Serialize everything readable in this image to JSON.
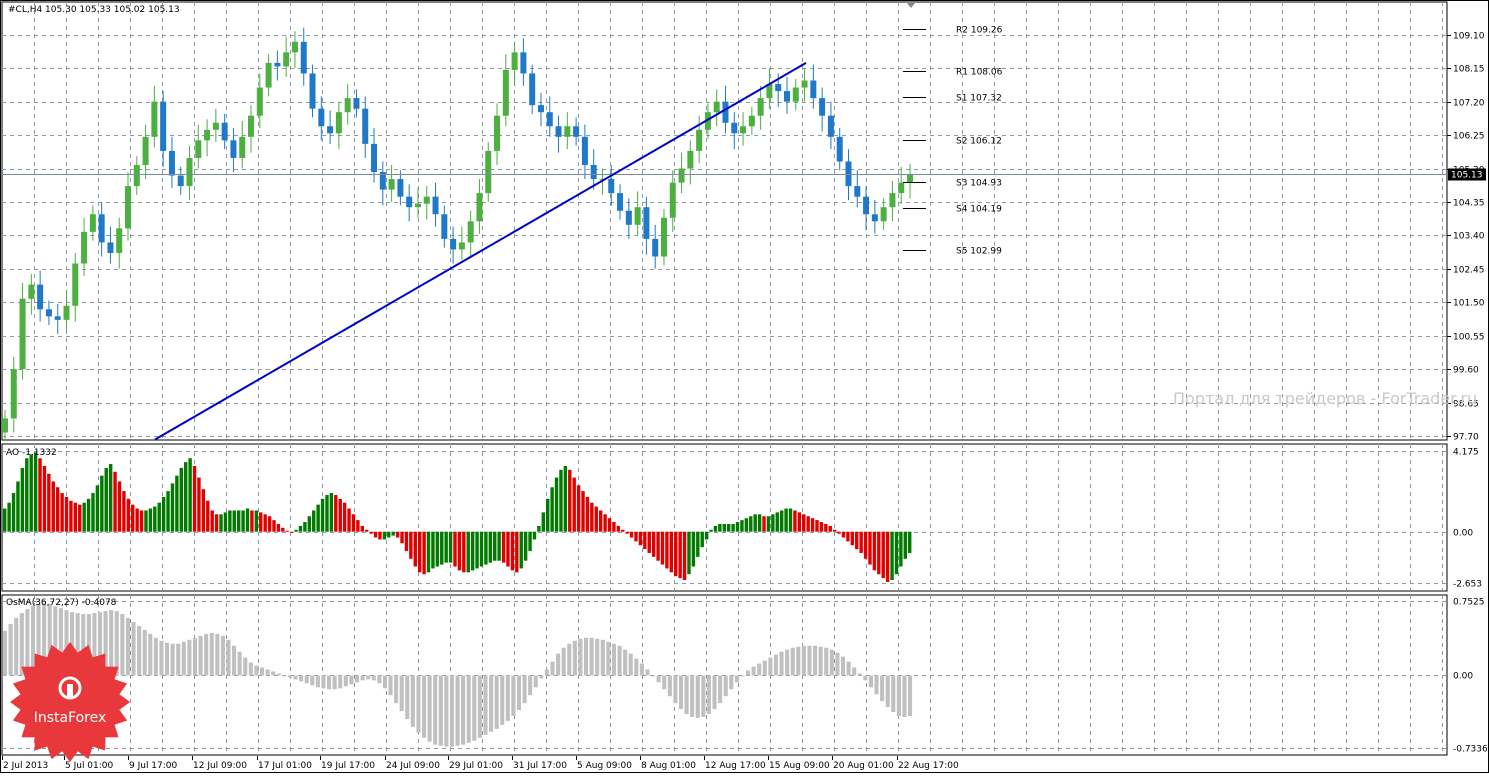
{
  "symbol_header": "#CL,H4  105.30 105.33 105.02 105.13",
  "watermark": "Портал для трейдеров - ForTrader.ru",
  "logo_text": "InstaForex",
  "colors": {
    "bull": "#4caf3f",
    "bear": "#1f78c8",
    "trendline": "#0000cc",
    "ao_up": "#007b00",
    "ao_down": "#e00000",
    "osma": "#c0c0c0",
    "grid": "#8a9aab",
    "logo": "#e8383b"
  },
  "price_panel": {
    "current_price": "105.13",
    "current_value": 105.13,
    "y_ticks": [
      "109.10",
      "108.15",
      "107.20",
      "106.25",
      "105.30",
      "104.35",
      "103.40",
      "102.45",
      "101.50",
      "100.55",
      "99.60",
      "98.65",
      "97.70"
    ],
    "y_values": [
      109.1,
      108.15,
      107.2,
      106.25,
      105.3,
      104.35,
      103.4,
      102.45,
      101.5,
      100.55,
      99.6,
      98.65,
      97.7
    ],
    "ylim": [
      97.7,
      109.86
    ],
    "pivots": [
      {
        "label": "R2 109.26",
        "value": 109.26
      },
      {
        "label": "R1 108.06",
        "value": 108.06
      },
      {
        "label": "S1 107.32",
        "value": 107.32
      },
      {
        "label": "S2 106.12",
        "value": 106.12
      },
      {
        "label": "S3 104.93",
        "value": 104.93
      },
      {
        "label": "S4 104.19",
        "value": 104.19
      },
      {
        "label": "S5 102.99",
        "value": 102.99
      }
    ]
  },
  "ao_panel": {
    "label": "AO -1.1332",
    "y_ticks": [
      "4.175",
      "0.00",
      "-2.653"
    ],
    "y_values": [
      4.175,
      0.0,
      -2.653
    ],
    "ylim": [
      -2.653,
      4.175
    ]
  },
  "osma_panel": {
    "label": "OsMA(36,72,27) -0.4078",
    "y_ticks": [
      "0.7525",
      "0.00",
      "-0.7336"
    ],
    "y_values": [
      0.7525,
      0.0,
      -0.7336
    ],
    "ylim": [
      -0.7336,
      0.7525
    ]
  },
  "x_ticks": [
    "2 Jul 2013",
    "5 Jul 01:00",
    "9 Jul 17:00",
    "12 Jul 09:00",
    "17 Jul 01:00",
    "19 Jul 17:00",
    "24 Jul 09:00",
    "29 Jul 01:00",
    "31 Jul 17:00",
    "5 Aug 09:00",
    "8 Aug 01:00",
    "12 Aug 17:00",
    "15 Aug 09:00",
    "20 Aug 01:00",
    "22 Aug 17:00"
  ],
  "chart_data": [
    {
      "type": "candlestick",
      "title": "#CL,H4",
      "ohlc_last": {
        "open": 105.3,
        "high": 105.33,
        "low": 105.02,
        "close": 105.13
      },
      "x_labels": [
        "2 Jul 2013",
        "5 Jul 01:00",
        "9 Jul 17:00",
        "12 Jul 09:00",
        "17 Jul 01:00",
        "19 Jul 17:00",
        "24 Jul 09:00",
        "29 Jul 01:00",
        "31 Jul 17:00",
        "5 Aug 09:00",
        "8 Aug 01:00",
        "12 Aug 17:00",
        "15 Aug 09:00",
        "20 Aug 01:00",
        "22 Aug 17:00"
      ],
      "close_path": [
        98.2,
        99.6,
        101.6,
        102.0,
        101.3,
        101.1,
        101.0,
        101.4,
        102.6,
        103.5,
        104.0,
        103.2,
        102.9,
        103.6,
        104.8,
        105.4,
        106.2,
        107.2,
        105.8,
        105.1,
        104.8,
        105.6,
        106.1,
        106.4,
        106.6,
        106.1,
        105.6,
        106.2,
        106.8,
        107.6,
        108.3,
        108.2,
        108.6,
        108.9,
        108.0,
        107.0,
        106.5,
        106.3,
        106.9,
        107.3,
        107.0,
        106.0,
        105.2,
        104.7,
        105.0,
        104.5,
        104.2,
        104.3,
        104.5,
        104.0,
        103.3,
        103.0,
        103.2,
        103.8,
        104.6,
        105.8,
        106.8,
        108.1,
        108.6,
        108.0,
        107.1,
        106.9,
        106.5,
        106.2,
        106.5,
        106.2,
        105.4,
        105.0,
        105.0,
        104.6,
        104.1,
        103.7,
        104.2,
        103.3,
        102.8,
        103.9,
        104.9,
        105.3,
        105.8,
        106.4,
        106.9,
        107.2,
        106.6,
        106.3,
        106.5,
        106.8,
        107.3,
        107.7,
        107.5,
        107.2,
        107.6,
        107.8,
        107.3,
        106.8,
        106.2,
        105.5,
        104.8,
        104.5,
        104.0,
        103.8,
        104.2,
        104.6,
        104.9,
        105.13
      ],
      "trendline": {
        "from": {
          "x": "5 Jul 01:00",
          "y": 97.6
        },
        "to": {
          "x": "15 Aug 09:00",
          "y": 108.3
        }
      }
    },
    {
      "type": "bar",
      "title": "AO -1.1332",
      "values": [
        1.2,
        1.5,
        2.0,
        2.6,
        3.3,
        3.8,
        4.0,
        4.1,
        3.8,
        3.4,
        3.0,
        2.6,
        2.3,
        2.0,
        1.8,
        1.6,
        1.5,
        1.4,
        1.5,
        1.7,
        2.0,
        2.4,
        2.9,
        3.3,
        3.5,
        3.1,
        2.6,
        2.1,
        1.7,
        1.4,
        1.2,
        1.1,
        1.1,
        1.2,
        1.3,
        1.5,
        1.8,
        2.1,
        2.5,
        2.9,
        3.3,
        3.6,
        3.8,
        3.4,
        2.8,
        2.2,
        1.6,
        1.1,
        0.9,
        0.9,
        1.0,
        1.1,
        1.1,
        1.1,
        1.1,
        1.2,
        1.1,
        1.1,
        1.0,
        0.9,
        0.8,
        0.6,
        0.4,
        0.2,
        0.05,
        0.0,
        0.1,
        0.3,
        0.5,
        0.8,
        1.1,
        1.4,
        1.7,
        1.9,
        2.0,
        1.9,
        1.7,
        1.5,
        1.2,
        0.9,
        0.6,
        0.3,
        0.1,
        -0.1,
        -0.3,
        -0.4,
        -0.4,
        -0.3,
        -0.2,
        -0.3,
        -0.6,
        -1.0,
        -1.4,
        -1.8,
        -2.1,
        -2.2,
        -2.1,
        -1.9,
        -1.8,
        -1.7,
        -1.6,
        -1.6,
        -1.8,
        -2.0,
        -2.1,
        -2.1,
        -2.0,
        -1.9,
        -1.8,
        -1.7,
        -1.6,
        -1.5,
        -1.5,
        -1.6,
        -1.8,
        -2.0,
        -2.1,
        -1.9,
        -1.5,
        -1.0,
        -0.4,
        0.3,
        1.0,
        1.7,
        2.3,
        2.8,
        3.2,
        3.4,
        3.2,
        2.8,
        2.4,
        2.1,
        1.8,
        1.5,
        1.3,
        1.1,
        0.9,
        0.7,
        0.5,
        0.3,
        0.1,
        -0.1,
        -0.3,
        -0.5,
        -0.7,
        -0.9,
        -1.1,
        -1.3,
        -1.5,
        -1.7,
        -1.9,
        -2.1,
        -2.3,
        -2.4,
        -2.5,
        -2.2,
        -1.8,
        -1.3,
        -0.8,
        -0.4,
        0.1,
        0.3,
        0.4,
        0.4,
        0.4,
        0.4,
        0.5,
        0.6,
        0.7,
        0.8,
        0.9,
        0.9,
        0.8,
        0.8,
        0.9,
        1.0,
        1.1,
        1.2,
        1.2,
        1.1,
        1.0,
        0.9,
        0.8,
        0.7,
        0.6,
        0.5,
        0.4,
        0.3,
        0.1,
        -0.1,
        -0.3,
        -0.5,
        -0.7,
        -0.9,
        -1.1,
        -1.4,
        -1.7,
        -2.0,
        -2.2,
        -2.4,
        -2.6,
        -2.5,
        -2.2,
        -1.8,
        -1.4,
        -1.1
      ]
    },
    {
      "type": "bar",
      "title": "OsMA(36,72,27) -0.4078",
      "values": [
        0.45,
        0.52,
        0.58,
        0.63,
        0.67,
        0.7,
        0.72,
        0.73,
        0.72,
        0.7,
        0.68,
        0.66,
        0.64,
        0.63,
        0.62,
        0.62,
        0.63,
        0.64,
        0.65,
        0.66,
        0.65,
        0.62,
        0.58,
        0.54,
        0.5,
        0.46,
        0.42,
        0.38,
        0.35,
        0.33,
        0.32,
        0.32,
        0.34,
        0.36,
        0.38,
        0.4,
        0.42,
        0.43,
        0.42,
        0.4,
        0.36,
        0.3,
        0.24,
        0.18,
        0.13,
        0.1,
        0.08,
        0.06,
        0.04,
        0.02,
        0.0,
        -0.02,
        -0.04,
        -0.06,
        -0.08,
        -0.1,
        -0.12,
        -0.13,
        -0.14,
        -0.14,
        -0.13,
        -0.11,
        -0.09,
        -0.07,
        -0.05,
        -0.04,
        -0.05,
        -0.08,
        -0.13,
        -0.2,
        -0.28,
        -0.36,
        -0.44,
        -0.52,
        -0.58,
        -0.63,
        -0.67,
        -0.7,
        -0.71,
        -0.72,
        -0.72,
        -0.71,
        -0.7,
        -0.68,
        -0.66,
        -0.63,
        -0.6,
        -0.57,
        -0.54,
        -0.5,
        -0.46,
        -0.41,
        -0.35,
        -0.28,
        -0.2,
        -0.12,
        -0.03,
        0.06,
        0.14,
        0.22,
        0.28,
        0.32,
        0.35,
        0.37,
        0.38,
        0.38,
        0.37,
        0.36,
        0.34,
        0.32,
        0.3,
        0.26,
        0.22,
        0.17,
        0.12,
        0.06,
        0.0,
        -0.07,
        -0.14,
        -0.21,
        -0.28,
        -0.34,
        -0.39,
        -0.42,
        -0.43,
        -0.42,
        -0.39,
        -0.34,
        -0.28,
        -0.21,
        -0.14,
        -0.07,
        0.0,
        0.05,
        0.09,
        0.12,
        0.15,
        0.18,
        0.21,
        0.24,
        0.26,
        0.28,
        0.29,
        0.3,
        0.3,
        0.3,
        0.29,
        0.28,
        0.26,
        0.23,
        0.19,
        0.14,
        0.08,
        0.02,
        -0.05,
        -0.12,
        -0.19,
        -0.26,
        -0.32,
        -0.37,
        -0.41,
        -0.42,
        -0.41
      ]
    }
  ]
}
